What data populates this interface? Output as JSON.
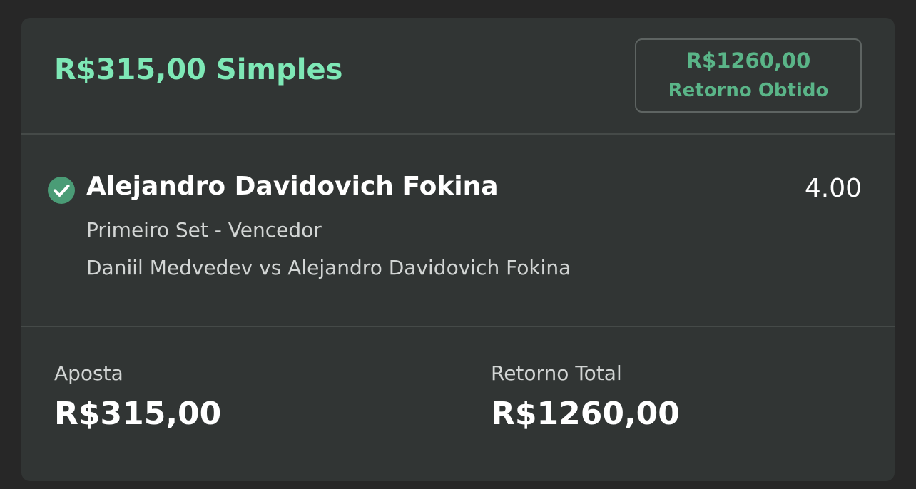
{
  "header": {
    "title": "R$315,00 Simples",
    "return_amount": "R$1260,00",
    "return_label": "Retorno Obtido"
  },
  "selection": {
    "status_icon": "check-circle-icon",
    "name": "Alejandro Davidovich Fokina",
    "odds": "4.00",
    "market": "Primeiro Set - Vencedor",
    "event": "Daniil Medvedev vs Alejandro Davidovich Fokina"
  },
  "footer": {
    "stake_label": "Aposta",
    "stake_value": "R$315,00",
    "total_label": "Retorno Total",
    "total_value": "R$1260,00"
  },
  "colors": {
    "title_green": "#7ee8b6",
    "return_green": "#5ab588",
    "check_green": "#4a9c76",
    "card_bg": "#313534",
    "page_bg": "#272727"
  }
}
